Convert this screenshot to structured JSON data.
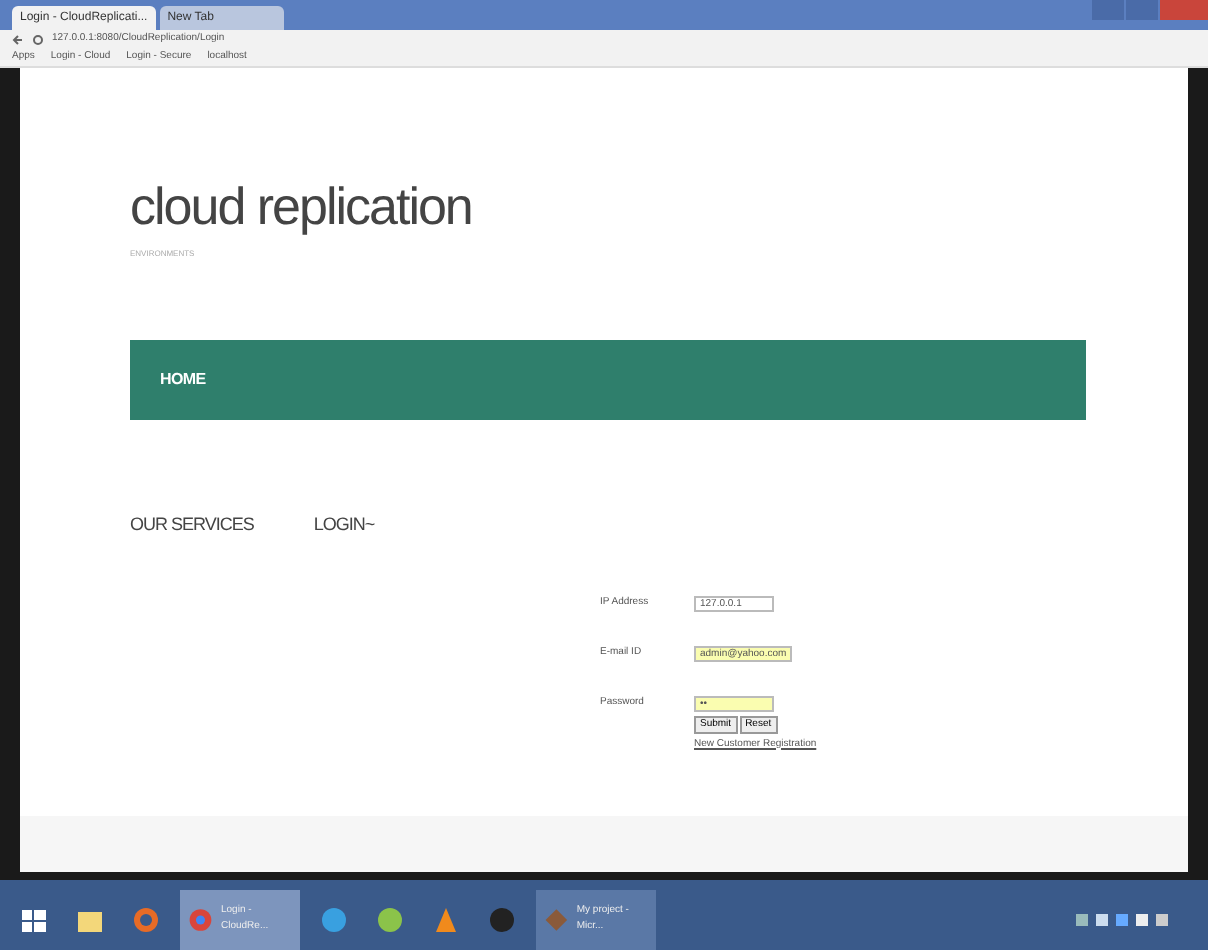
{
  "browser": {
    "tabs": [
      {
        "label": "Login - CloudReplicati...",
        "selected": true
      },
      {
        "label": "New Tab",
        "selected": false
      }
    ],
    "address": "127.0.0.1:8080/CloudReplication/Login",
    "bookmarks": [
      "Apps",
      "Login - Cloud",
      "Login - Secure",
      "localhost"
    ]
  },
  "header": {
    "title": "cloud replication",
    "subtitle": "ENVIRONMENTS"
  },
  "nav": {
    "items": [
      {
        "label": "HOME",
        "selected": true
      }
    ]
  },
  "menu": [
    "OUR SERVICES",
    "LOGIN~"
  ],
  "form": {
    "fields": [
      {
        "label": "IP Address",
        "value": "127.0.0.1",
        "autofilled": false
      },
      {
        "label": "E-mail ID",
        "value": "admin@yahoo.com",
        "autofilled": true
      },
      {
        "label": "Password",
        "value": "••",
        "autofilled": true
      }
    ],
    "buttons": [
      "Submit",
      "Reset"
    ],
    "link": "New Customer Registration"
  },
  "taskbar": {
    "apps": [
      {
        "kind": "start"
      },
      {
        "kind": "folder"
      },
      {
        "kind": "firefox"
      },
      {
        "kind": "chrome",
        "label": "Login - CloudRe...",
        "selected": true
      },
      {
        "kind": "ie"
      },
      {
        "kind": "green"
      },
      {
        "kind": "vlc"
      },
      {
        "kind": "dark"
      },
      {
        "kind": "project",
        "label": "My project - Micr...",
        "selected": false
      }
    ]
  }
}
